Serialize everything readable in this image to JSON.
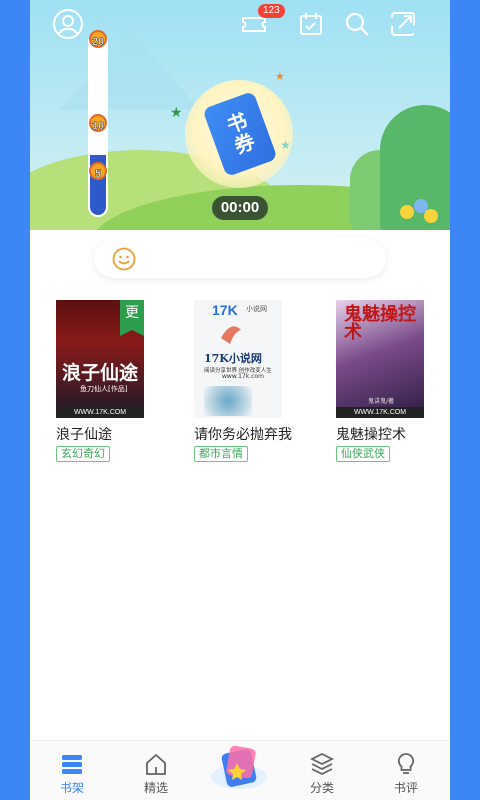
{
  "timer": "00:00",
  "badge_count": "123",
  "progress": {
    "marks": [
      "20",
      "10",
      "5"
    ],
    "fill_fraction": 0.33
  },
  "hero_ticket_text": "书券",
  "notice_text": "",
  "books": [
    {
      "title": "浪子仙途",
      "genre": "玄幻奇幻",
      "cover_title": "浪子仙途",
      "cover_author": "鱼刀仙人[作品]",
      "cover_foot": "WWW.17K.COM",
      "update_tag": "更"
    },
    {
      "title": "请你务必抛弃我",
      "genre": "都市言情",
      "cover_brand": "17K",
      "cover_brand_sub": "小说网",
      "cover_title": "17K小说网",
      "cover_slogan": "阅读分享世界 创作改变人生",
      "cover_url": "www.17k.com"
    },
    {
      "title": "鬼魅操控术",
      "genre": "仙侠武侠",
      "cover_title": "鬼魅操控术",
      "cover_author": "鬼讲鬼/著",
      "cover_foot": "WWW.17K.COM"
    }
  ],
  "nav": [
    {
      "label": "书架",
      "icon": "bookshelf-icon",
      "active": true
    },
    {
      "label": "精选",
      "icon": "home-icon",
      "active": false
    },
    {
      "label": "",
      "icon": "center-feature-icon",
      "active": false
    },
    {
      "label": "分类",
      "icon": "layers-icon",
      "active": false
    },
    {
      "label": "书评",
      "icon": "lightbulb-icon",
      "active": false
    }
  ],
  "colors": {
    "accent": "#3d86f6",
    "tag_green": "#3aa65a",
    "progress_blue": "#2e59c9"
  }
}
